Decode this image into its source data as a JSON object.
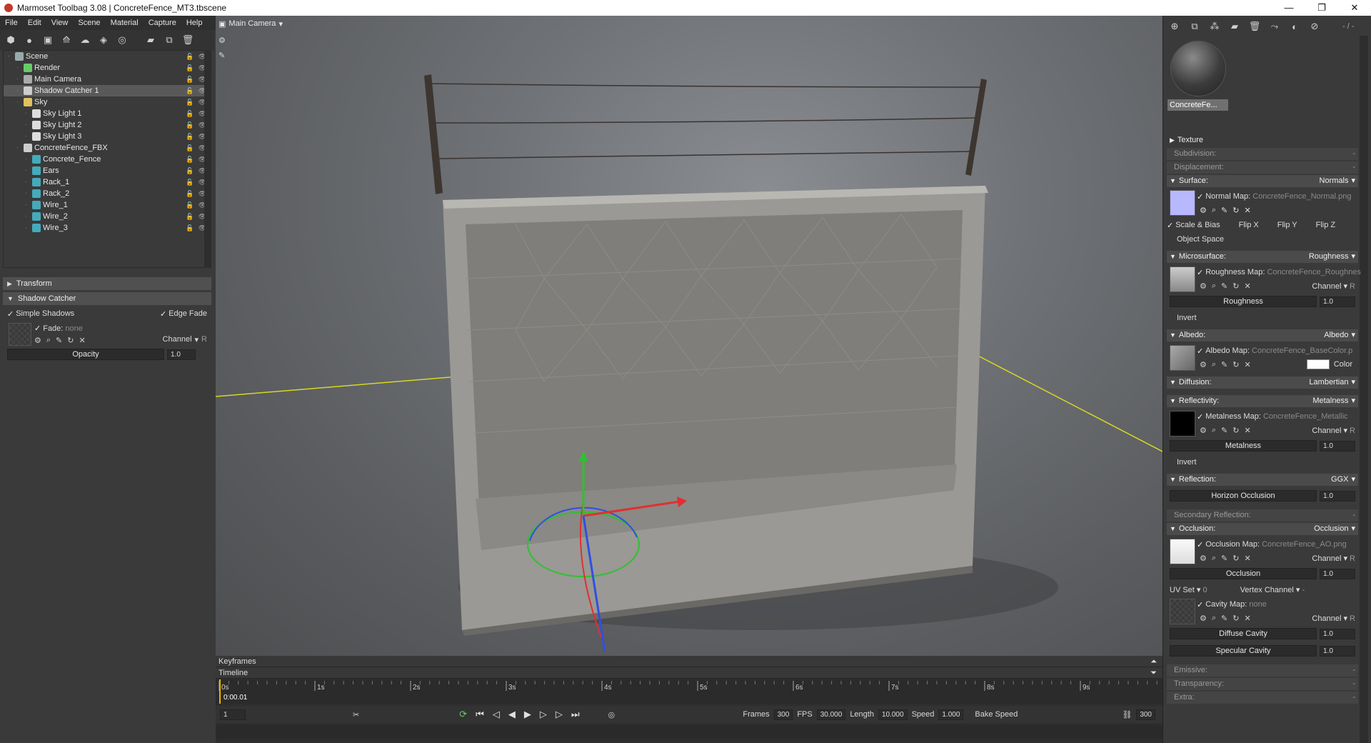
{
  "window": {
    "title": "Marmoset Toolbag 3.08  |  ConcreteFence_MT3.tbscene",
    "min": "—",
    "restore": "❐",
    "close": "✕"
  },
  "menu": [
    "File",
    "Edit",
    "View",
    "Scene",
    "Material",
    "Capture",
    "Help"
  ],
  "scene_tree": [
    {
      "label": "Scene",
      "depth": 0,
      "icon": "scene-icon",
      "color": "#9aa",
      "selected": false
    },
    {
      "label": "Render",
      "depth": 1,
      "icon": "render-icon",
      "color": "#6c6",
      "selected": false
    },
    {
      "label": "Main Camera",
      "depth": 1,
      "icon": "camera-icon",
      "color": "#aaa",
      "selected": false
    },
    {
      "label": "Shadow Catcher 1",
      "depth": 1,
      "icon": "shadow-catcher-icon",
      "color": "#ccc",
      "selected": true
    },
    {
      "label": "Sky",
      "depth": 1,
      "icon": "sky-icon",
      "color": "#e0c060",
      "selected": false
    },
    {
      "label": "Sky Light 1",
      "depth": 2,
      "icon": "light-icon",
      "color": "#ddd",
      "selected": false
    },
    {
      "label": "Sky Light 2",
      "depth": 2,
      "icon": "light-icon",
      "color": "#ddd",
      "selected": false
    },
    {
      "label": "Sky Light 3",
      "depth": 2,
      "icon": "light-icon",
      "color": "#ddd",
      "selected": false
    },
    {
      "label": "ConcreteFence_FBX",
      "depth": 1,
      "icon": "fbx-icon",
      "color": "#ccc",
      "selected": false
    },
    {
      "label": "Concrete_Fence",
      "depth": 2,
      "icon": "mesh-icon",
      "color": "#4ab",
      "selected": false
    },
    {
      "label": "Ears",
      "depth": 2,
      "icon": "mesh-icon",
      "color": "#4ab",
      "selected": false
    },
    {
      "label": "Rack_1",
      "depth": 2,
      "icon": "mesh-icon",
      "color": "#4ab",
      "selected": false
    },
    {
      "label": "Rack_2",
      "depth": 2,
      "icon": "mesh-icon",
      "color": "#4ab",
      "selected": false
    },
    {
      "label": "Wire_1",
      "depth": 2,
      "icon": "mesh-icon",
      "color": "#4ab",
      "selected": false
    },
    {
      "label": "Wire_2",
      "depth": 2,
      "icon": "mesh-icon",
      "color": "#4ab",
      "selected": false
    },
    {
      "label": "Wire_3",
      "depth": 2,
      "icon": "mesh-icon",
      "color": "#4ab",
      "selected": false
    }
  ],
  "left_props": {
    "transform": "Transform",
    "shadow_catcher": "Shadow Catcher",
    "simple_shadows": "Simple Shadows",
    "edge_fade": "Edge Fade",
    "fade_label": "Fade:",
    "fade_value": "none",
    "channel": "Channel",
    "channel_value": "R",
    "opacity_label": "Opacity",
    "opacity_value": "1.0"
  },
  "viewport": {
    "camera": "Main Camera"
  },
  "timeline": {
    "keyframes": "Keyframes",
    "timeline": "Timeline",
    "current_time": "0:00.01",
    "ticks": [
      "0s",
      "1s",
      "2s",
      "3s",
      "4s",
      "5s",
      "6s",
      "7s",
      "8s",
      "9s"
    ],
    "frame_field": "1",
    "frames_label": "Frames",
    "frames_value": "300",
    "fps_label": "FPS",
    "fps_value": "30.000",
    "length_label": "Length",
    "length_value": "10.000",
    "speed_label": "Speed",
    "speed_value": "1.000",
    "bake_speed": "Bake Speed",
    "end_frame": "300"
  },
  "material": {
    "thumb_name": "ConcreteFe...",
    "toolbar_value": "- / -",
    "texture": "Texture",
    "subdivision": "Subdivision:",
    "displacement": "Displacement:",
    "dash": "-",
    "surface": "Surface:",
    "surface_value": "Normals",
    "normal_map_label": "Normal Map:",
    "normal_map_file": "ConcreteFence_Normal.png",
    "scale_bias": "Scale & Bias",
    "flip_x": "Flip X",
    "flip_y": "Flip Y",
    "flip_z": "Flip Z",
    "object_space": "Object Space",
    "microsurface": "Microsurface:",
    "microsurface_value": "Roughness",
    "roughness_map_label": "Roughness Map:",
    "roughness_map_file": "ConcreteFence_Roughness",
    "channel": "Channel",
    "channel_r": "R",
    "roughness": "Roughness",
    "roughness_value": "1.0",
    "invert": "Invert",
    "albedo": "Albedo:",
    "albedo_value": "Albedo",
    "albedo_map_label": "Albedo Map:",
    "albedo_map_file": "ConcreteFence_BaseColor.p",
    "color": "Color",
    "diffusion": "Diffusion:",
    "diffusion_value": "Lambertian",
    "reflectivity": "Reflectivity:",
    "reflectivity_value": "Metalness",
    "metalness_map_label": "Metalness Map:",
    "metalness_map_file": "ConcreteFence_Metallic",
    "metalness": "Metalness",
    "metalness_value": "1.0",
    "reflection": "Reflection:",
    "reflection_value": "GGX",
    "horizon_occlusion": "Horizon Occlusion",
    "horizon_value": "1.0",
    "secondary_reflection": "Secondary Reflection:",
    "occlusion": "Occlusion:",
    "occlusion_value": "Occlusion",
    "occlusion_map_label": "Occlusion Map:",
    "occlusion_map_file": "ConcreteFence_AO.png",
    "occlusion_slider": "Occlusion",
    "occlusion_slider_value": "1.0",
    "uv_set": "UV Set",
    "uv_value": "0",
    "vertex_channel": "Vertex Channel",
    "cavity_map_label": "Cavity Map:",
    "cavity_map_value": "none",
    "diffuse_cavity": "Diffuse Cavity",
    "diffuse_cavity_value": "1.0",
    "specular_cavity": "Specular Cavity",
    "specular_cavity_value": "1.0",
    "emissive": "Emissive:",
    "transparency": "Transparency:",
    "extra": "Extra:"
  },
  "colors": {
    "normal_swatch": "#b8b8ff",
    "albedo_color": "#ffffff",
    "selection": "#595959",
    "gizmo_x": "#e03030",
    "gizmo_y": "#30c030",
    "gizmo_z": "#3050e0",
    "shadow_line": "#d8d820"
  }
}
